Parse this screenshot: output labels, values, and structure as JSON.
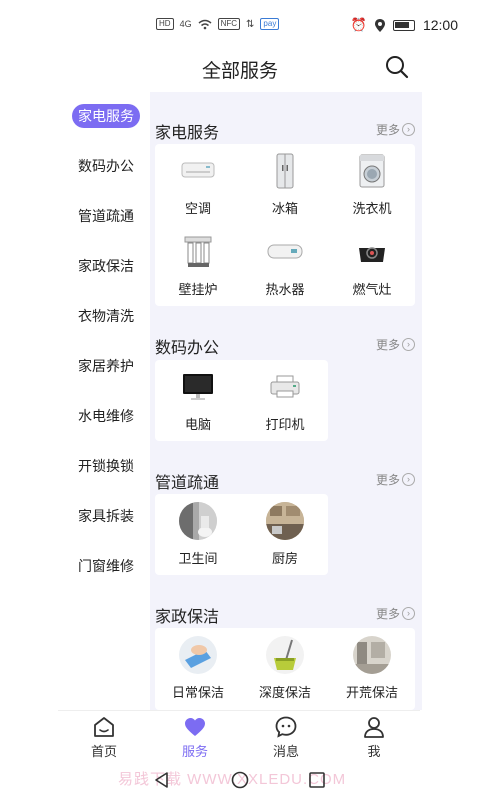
{
  "status": {
    "left_chips": [
      "HD",
      "4G",
      "NFC",
      "pay"
    ],
    "time": "12:00"
  },
  "header": {
    "title": "全部服务"
  },
  "sidebar": {
    "items": [
      {
        "label": "家电服务"
      },
      {
        "label": "数码办公"
      },
      {
        "label": "管道疏通"
      },
      {
        "label": "家政保洁"
      },
      {
        "label": "衣物清洗"
      },
      {
        "label": "家居养护"
      },
      {
        "label": "水电维修"
      },
      {
        "label": "开锁换锁"
      },
      {
        "label": "家具拆装"
      },
      {
        "label": "门窗维修"
      }
    ]
  },
  "sections": [
    {
      "title": "家电服务",
      "more": "更多",
      "items": [
        {
          "label": "空调",
          "icon": "air-conditioner-icon"
        },
        {
          "label": "冰箱",
          "icon": "fridge-icon"
        },
        {
          "label": "洗衣机",
          "icon": "washing-machine-icon"
        },
        {
          "label": "壁挂炉",
          "icon": "wall-boiler-icon"
        },
        {
          "label": "热水器",
          "icon": "water-heater-icon"
        },
        {
          "label": "燃气灶",
          "icon": "gas-stove-icon"
        }
      ]
    },
    {
      "title": "数码办公",
      "more": "更多",
      "items": [
        {
          "label": "电脑",
          "icon": "computer-icon"
        },
        {
          "label": "打印机",
          "icon": "printer-icon"
        }
      ]
    },
    {
      "title": "管道疏通",
      "more": "更多",
      "items": [
        {
          "label": "卫生间",
          "icon": "bathroom-icon"
        },
        {
          "label": "厨房",
          "icon": "kitchen-icon"
        }
      ]
    },
    {
      "title": "家政保洁",
      "more": "更多",
      "items": [
        {
          "label": "日常保洁",
          "icon": "daily-cleaning-icon"
        },
        {
          "label": "深度保洁",
          "icon": "deep-cleaning-icon"
        },
        {
          "label": "开荒保洁",
          "icon": "reclamation-cleaning-icon"
        }
      ]
    }
  ],
  "bottom_nav": [
    {
      "label": "首页"
    },
    {
      "label": "服务"
    },
    {
      "label": "消息"
    },
    {
      "label": "我"
    }
  ],
  "watermark": "易践下载 WWW.XXLEDU.COM",
  "colors": {
    "accent": "#7c6cf2",
    "panel_bg": "#f3f3fb"
  }
}
